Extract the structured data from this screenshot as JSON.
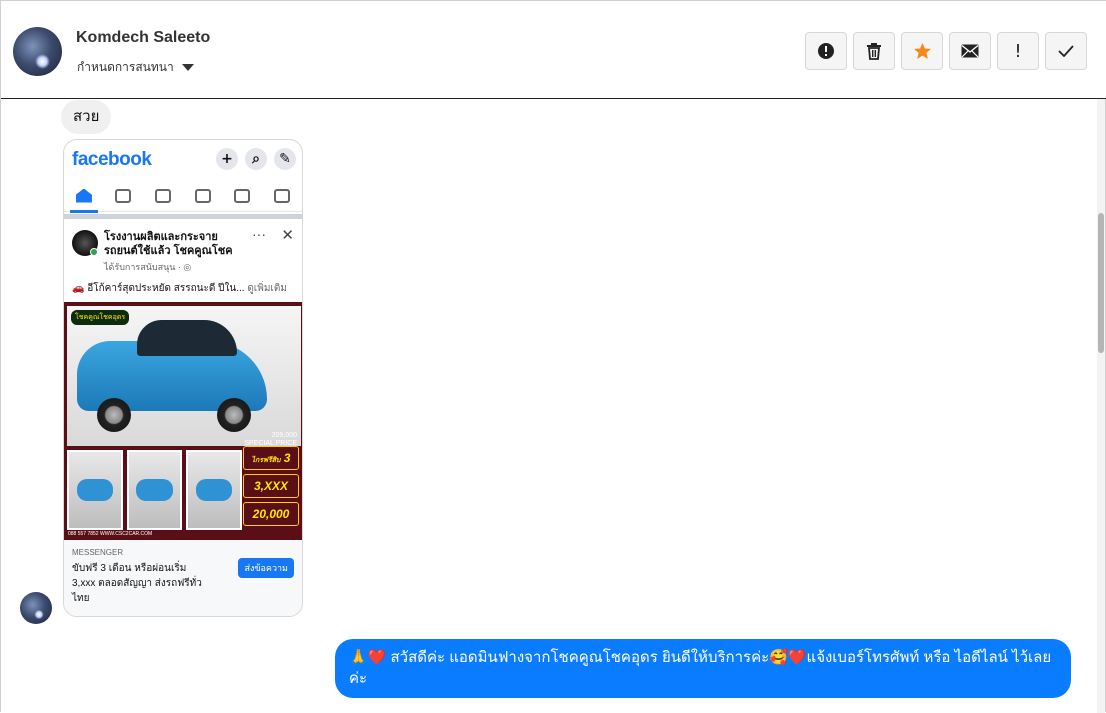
{
  "header": {
    "contact_name": "Komdech Saleeto",
    "status_label": "กำหนดการสนทนา",
    "actions": [
      {
        "name": "spam-report",
        "icon": "alert-circle-icon"
      },
      {
        "name": "delete",
        "icon": "trash-icon"
      },
      {
        "name": "star",
        "icon": "star-icon",
        "color": "#f38a1a"
      },
      {
        "name": "mark-unread",
        "icon": "envelope-icon"
      },
      {
        "name": "important",
        "icon": "exclamation-icon",
        "label": "!"
      },
      {
        "name": "done",
        "icon": "checkmark-icon"
      }
    ]
  },
  "messages": {
    "incoming_text": "สวย",
    "outgoing_text": "🙏❤️ สวัสดีค่ะ แอดมินฟางจากโชคคูณโชคอุดร ยินดีให้บริการค่ะ🥰❤️แจ้งเบอร์โทรศัพท์ หรือ ไอดีไลน์  ไว้เลยค่ะ",
    "outgoing_color": "#0a7cff"
  },
  "attachment": {
    "brand": "facebook",
    "page_name": "โรงงานผลิตและกระจายรถยนต์ใช้แล้ว โชคคูณโชค",
    "sponsored": "ได้รับการสนับสนุน · ",
    "post_text": "🚗 อีโก้คาร์สุดประหยัด สรรถนะดี ปีใน...",
    "see_more": "ดูเพิ่มเติม",
    "ad_brand": "โชคคูณโชคอุดร",
    "ad_price": "209,000",
    "ad_price_note": "SPECIAL PRICE",
    "promo_1_small": "ไกรฟรีสิบ",
    "promo_1": "3",
    "promo_2": "3,XXX",
    "promo_3": "20,000",
    "ad_footer": "088 557 7852  WWW.CSC2CAR.COM",
    "messenger_label": "MESSENGER",
    "messenger_text": "ขับฟรี 3 เดือน หรือผ่อนเริ่ม 3,xxx ตลอดสัญญา ส่งรถฟรีทั่วไทย",
    "messenger_button": "ส่งข้อความ"
  }
}
